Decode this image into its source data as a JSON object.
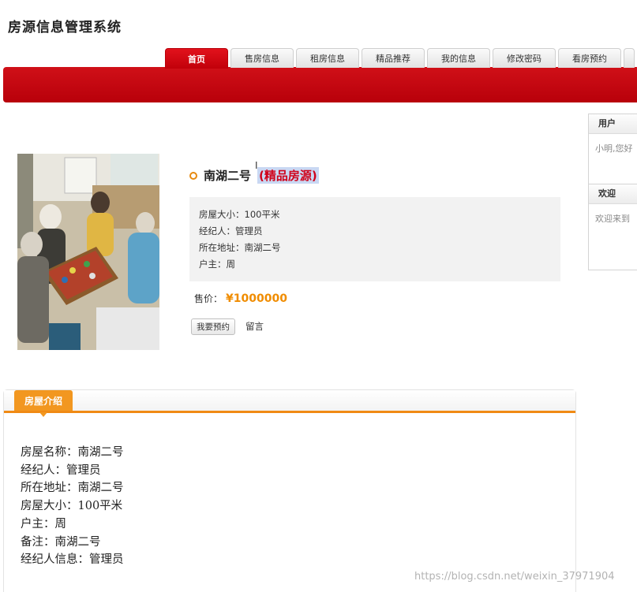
{
  "site": {
    "title": "房源信息管理系统"
  },
  "nav": {
    "tabs": [
      {
        "label": "首页"
      },
      {
        "label": "售房信息"
      },
      {
        "label": "租房信息"
      },
      {
        "label": "精品推荐"
      },
      {
        "label": "我的信息"
      },
      {
        "label": "修改密码"
      },
      {
        "label": "看房预约"
      }
    ]
  },
  "sidebar": {
    "user": {
      "title": "用户",
      "text": "小明,您好"
    },
    "welcome": {
      "title": "欢迎",
      "text": "欢迎来到"
    }
  },
  "house": {
    "name": "南湖二号",
    "tag": "(精品房源)",
    "details": [
      {
        "label": "房屋大小：",
        "value": "100平米"
      },
      {
        "label": "经纪人：",
        "value": "管理员"
      },
      {
        "label": "所在地址：",
        "value": "南湖二号"
      },
      {
        "label": "户主：",
        "value": "周"
      }
    ],
    "price_label": "售价：",
    "price_value": "¥1000000",
    "reserve_button": "我要预约",
    "comment_link": "留言"
  },
  "intro": {
    "title": "房屋介绍",
    "lines": [
      "房屋名称：南湖二号",
      "经纪人：管理员",
      "所在地址：南湖二号",
      "房屋大小：100平米",
      "户主：周",
      "备注：南湖二号",
      "经纪人信息：管理员"
    ]
  },
  "watermark": "https://blog.csdn.net/weixin_37971904"
}
